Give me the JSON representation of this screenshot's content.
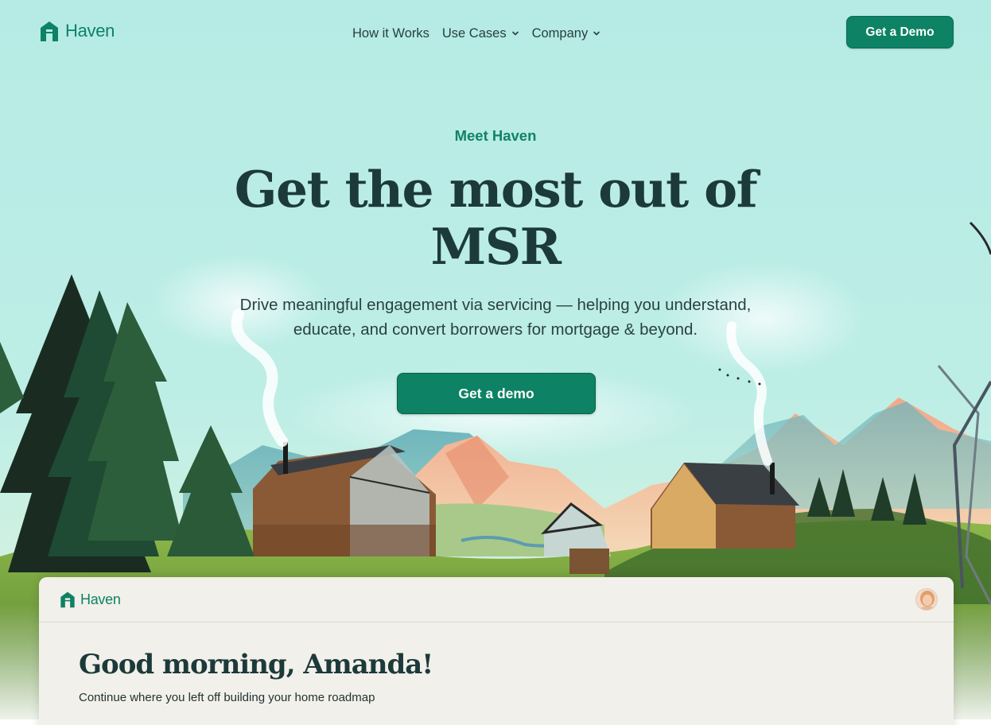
{
  "nav": {
    "brand": "Haven",
    "links": [
      {
        "label": "How it Works",
        "has_dropdown": false
      },
      {
        "label": "Use Cases",
        "has_dropdown": true
      },
      {
        "label": "Company",
        "has_dropdown": true
      }
    ],
    "cta_label": "Get a Demo"
  },
  "hero": {
    "eyebrow": "Meet Haven",
    "title_line1": "Get the most out of",
    "title_line2": "MSR",
    "subtitle_line1": "Drive meaningful engagement via servicing — helping you understand,",
    "subtitle_line2": "educate, and convert borrowers for mortgage & beyond.",
    "cta_label": "Get a demo"
  },
  "app_preview": {
    "brand": "Haven",
    "greeting": "Good morning, Amanda!",
    "subtext": "Continue where you left off building your home roadmap"
  },
  "colors": {
    "sky": "#b6ebe5",
    "brand_green": "#0d8264",
    "heading": "#1d3a3a",
    "card_bg": "#f2f0ea"
  },
  "icons": {
    "logo": "house-h-logo-icon",
    "dropdown": "chevron-down-icon",
    "avatar": "user-avatar"
  }
}
